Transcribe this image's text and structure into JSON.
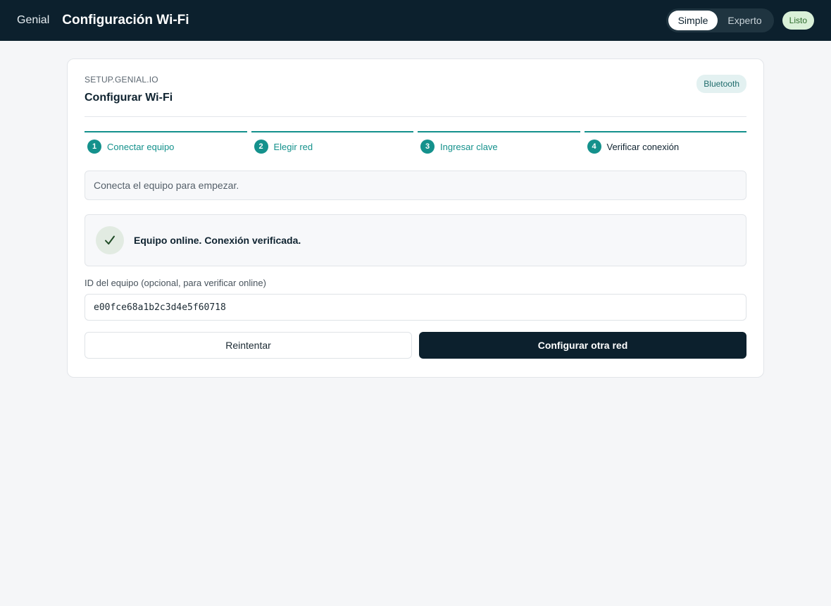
{
  "header": {
    "brand": "Genial",
    "title": "Configuración Wi-Fi",
    "modes": [
      "Simple",
      "Experto"
    ],
    "active_mode": "Simple",
    "status": "Listo"
  },
  "card": {
    "eyebrow": "SETUP.GENIAL.IO",
    "title": "Configurar Wi-Fi",
    "badge": "Bluetooth"
  },
  "steps": [
    {
      "num": "1",
      "label": "Conectar equipo"
    },
    {
      "num": "2",
      "label": "Elegir red"
    },
    {
      "num": "3",
      "label": "Ingresar clave"
    },
    {
      "num": "4",
      "label": "Verificar conexión"
    }
  ],
  "info": {
    "text": "Conecta el equipo para empezar."
  },
  "success": {
    "text": "Equipo online. Conexión verificada.",
    "icon": "check-icon"
  },
  "device_id": {
    "label": "ID del equipo (opcional, para verificar online)",
    "value": "e00fce68a1b2c3d4e5f60718"
  },
  "actions": {
    "retry_label": "Reintentar",
    "configure_label": "Configurar otra red"
  },
  "colors": {
    "accent": "#14918c",
    "dark": "#0c202d",
    "success_bg": "#d9f0d8"
  }
}
